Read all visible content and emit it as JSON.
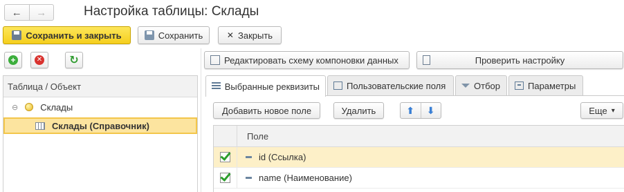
{
  "window": {
    "title": "Настройка таблицы: Склады",
    "nav_back": "←",
    "nav_forward": "→"
  },
  "toolbar": {
    "save_close_label": "Сохранить и закрыть",
    "save_label": "Сохранить",
    "close_label": "Закрыть",
    "close_icon": "✕"
  },
  "left_panel": {
    "add_icon": "+",
    "delete_icon": "✕",
    "refresh_icon": "↻",
    "tree_header": "Таблица / Объект",
    "tree_items": [
      {
        "label": "Склады",
        "toggle": "⊖",
        "icon": "folder-ball-icon"
      },
      {
        "label": "Склады (Справочник)",
        "icon": "table-icon",
        "selected": true
      }
    ]
  },
  "right_panel": {
    "edit_schema_label": "Редактировать схему компоновки данных",
    "check_settings_label": "Проверить настройку",
    "tabs": [
      {
        "label": "Выбранные реквизиты",
        "active": true
      },
      {
        "label": "Пользовательские поля",
        "active": false
      },
      {
        "label": "Отбор",
        "active": false
      },
      {
        "label": "Параметры",
        "active": false
      }
    ],
    "add_field_label": "Добавить новое поле",
    "delete_label": "Удалить",
    "move_up": "⬆",
    "move_down": "⬇",
    "more_label": "Еще",
    "more_caret": "▾",
    "grid": {
      "column_header": "Поле",
      "rows": [
        {
          "label": "id (Ссылка)",
          "checked": true,
          "selected": true
        },
        {
          "label": "name (Наименование)",
          "checked": true,
          "selected": false
        }
      ]
    }
  },
  "colors": {
    "primary_button": "#f5cf1e",
    "selection": "#fce49f",
    "check_green": "#2c9e2c"
  }
}
